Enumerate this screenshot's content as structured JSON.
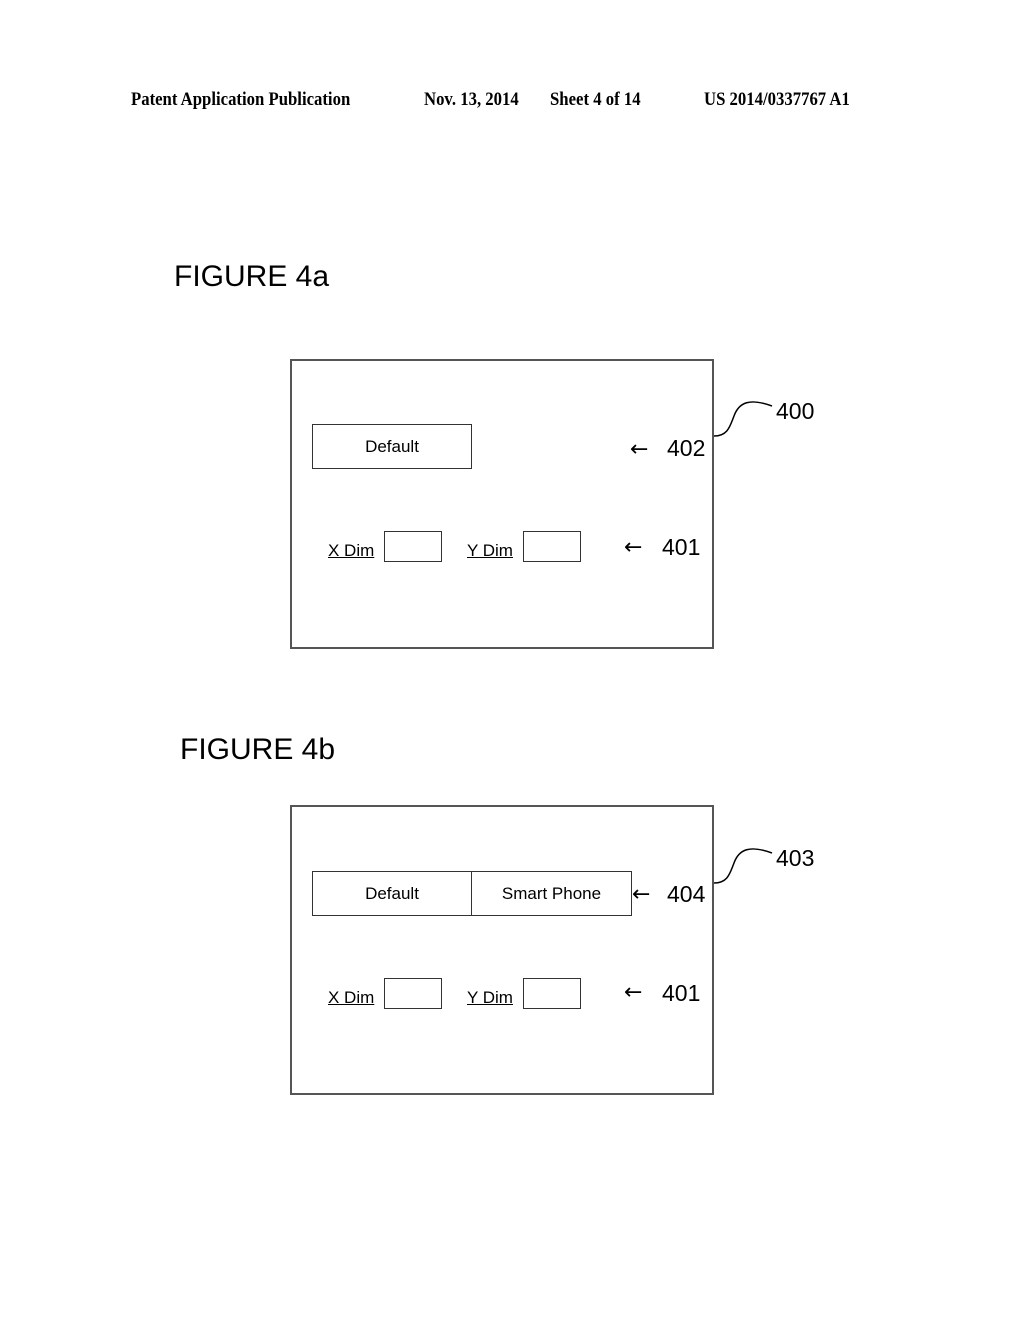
{
  "header": {
    "publication": "Patent Application Publication",
    "date": "Nov. 13, 2014",
    "sheet": "Sheet 4 of 14",
    "number": "US 2014/0337767 A1"
  },
  "figures": [
    {
      "title": "FIGURE 4a",
      "panel_ref": "400",
      "buttons": [
        "Default"
      ],
      "buttons_ref": "402",
      "dims": {
        "x_label": "X Dim",
        "x_value": "",
        "y_label": "Y Dim",
        "y_value": "",
        "ref": "401"
      }
    },
    {
      "title": "FIGURE 4b",
      "panel_ref": "403",
      "buttons": [
        "Default",
        "Smart Phone"
      ],
      "buttons_ref": "404",
      "dims": {
        "x_label": "X Dim",
        "x_value": "",
        "y_label": "Y Dim",
        "y_value": "",
        "ref": "401"
      }
    }
  ],
  "icons": {
    "arrow": "←"
  }
}
